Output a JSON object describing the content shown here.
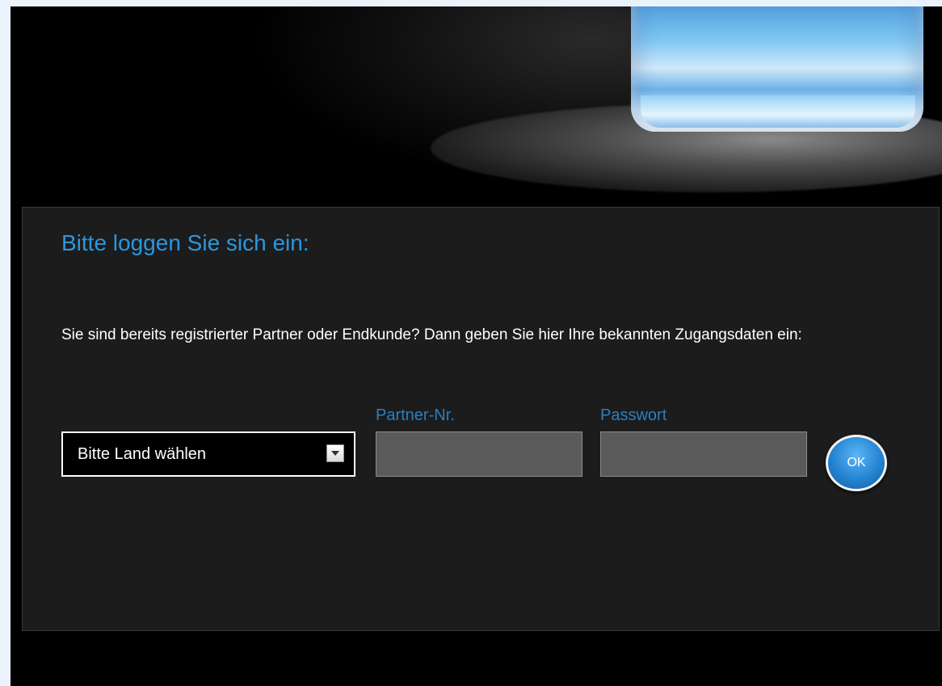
{
  "login": {
    "title": "Bitte loggen Sie sich ein:",
    "intro": "Sie sind bereits registrierter Partner oder Endkunde? Dann geben Sie hier Ihre bekannten Zugangsdaten ein:",
    "country_select": {
      "selected": "Bitte Land wählen"
    },
    "partner_field": {
      "label": "Partner-Nr.",
      "value": ""
    },
    "password_field": {
      "label": "Passwort",
      "value": ""
    },
    "submit_label": "OK"
  },
  "colors": {
    "accent": "#2a97e0",
    "panel_bg": "#1c1c1c",
    "page_bg": "#000000",
    "input_bg": "#5a5a5a"
  },
  "icons": {
    "dropdown": "chevron-down-icon"
  }
}
